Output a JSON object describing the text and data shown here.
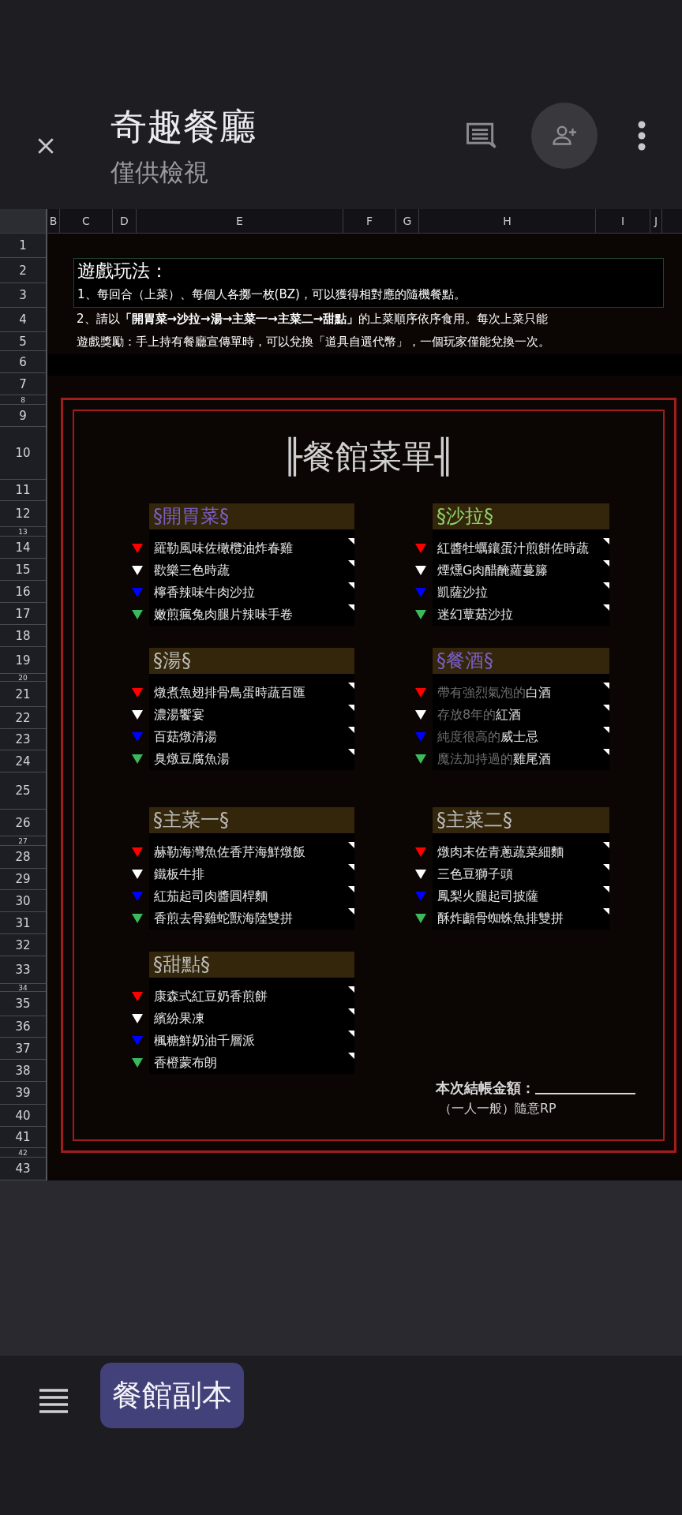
{
  "toolbar": {
    "title": "奇趣餐廳",
    "subtitle": "僅供檢視"
  },
  "columns": [
    "B",
    "C",
    "D",
    "E",
    "F",
    "G",
    "H",
    "I",
    "J"
  ],
  "rows": [
    "1",
    "2",
    "3",
    "4",
    "5",
    "6",
    "7",
    "8",
    "9",
    "10",
    "11",
    "12",
    "13",
    "14",
    "15",
    "16",
    "17",
    "18",
    "19",
    "20",
    "21",
    "22",
    "23",
    "24",
    "25",
    "26",
    "27",
    "28",
    "29",
    "30",
    "31",
    "32",
    "33",
    "34",
    "35",
    "36",
    "37",
    "38",
    "39",
    "40",
    "41",
    "42",
    "43"
  ],
  "rules": {
    "title": "遊戲玩法：",
    "lines": [
      "1、每回合（上菜）、每個人各擲一枚(BZ)，可以獲得相對應的隨機餐點。",
      "2、請以**「開胃菜→沙拉→湯→主菜一→主菜二→甜點」**的上菜順序依序食用。每次上菜只能",
      "遊戲獎勵：手上持有餐廳宣傳單時，可以兌換「道具自選代幣」，一個玩家僅能兌換一次。"
    ]
  },
  "menu": {
    "title": "╟餐館菜單╢",
    "sections": [
      {
        "title": "§開胃菜§",
        "color": "#7b5fc4",
        "items": [
          {
            "name": "羅勒風味佐橄欖油炸春雞",
            "color": "#ff0000"
          },
          {
            "name": "歡樂三色時蔬",
            "color": "#ffffff"
          },
          {
            "name": "檸香辣味牛肉沙拉",
            "color": "#0000ff"
          },
          {
            "name": "嫩煎瘋兔肉腿片辣味手卷",
            "color": "#3cb95a"
          }
        ]
      },
      {
        "title": "§沙拉§",
        "color": "#8fd06a",
        "items": [
          {
            "name": "紅醬牡蠣鑲蛋汁煎餅佐時蔬",
            "color": "#ff0000"
          },
          {
            "name": "煙燻G肉醋醃蘿蔓籐",
            "color": "#ffffff"
          },
          {
            "name": "凱薩沙拉",
            "color": "#0000ff"
          },
          {
            "name": "迷幻蕈菇沙拉",
            "color": "#3cb95a"
          }
        ]
      },
      {
        "title": "§湯§",
        "color": "#bbbbbb",
        "items": [
          {
            "name": "燉煮魚翅排骨鳥蛋時蔬百匯",
            "color": "#ff0000"
          },
          {
            "name": "濃湯饗宴",
            "color": "#ffffff"
          },
          {
            "name": "百菇燉清湯",
            "color": "#0000ff"
          },
          {
            "name": "臭燉豆腐魚湯",
            "color": "#3cb95a"
          }
        ]
      },
      {
        "title": "§餐酒§",
        "color": "#7b5fc4",
        "items": [
          {
            "prefix": "帶有強烈氣泡的",
            "name": "白酒",
            "color": "#ff0000"
          },
          {
            "prefix": "存放8年的",
            "name": "紅酒",
            "color": "#ffffff"
          },
          {
            "prefix": "純度很高的",
            "name": "威士忌",
            "color": "#0000ff"
          },
          {
            "prefix": "魔法加持過的",
            "name": "雞尾酒",
            "color": "#3cb95a"
          }
        ]
      },
      {
        "title": "§主菜一§",
        "color": "#bbbbbb",
        "items": [
          {
            "name": "赫勒海灣魚佐香芹海鮮燉飯",
            "color": "#ff0000"
          },
          {
            "name": "鐵板牛排",
            "color": "#ffffff"
          },
          {
            "name": "紅茄起司肉醬圓桿麵",
            "color": "#0000ff"
          },
          {
            "name": "香煎去骨雞蛇獸海陸雙拼",
            "color": "#3cb95a"
          }
        ]
      },
      {
        "title": "§主菜二§",
        "color": "#bbbbbb",
        "items": [
          {
            "name": "燉肉末佐青蔥蔬菜細麵",
            "color": "#ff0000"
          },
          {
            "name": "三色豆獅子頭",
            "color": "#ffffff"
          },
          {
            "name": "鳳梨火腿起司披薩",
            "color": "#0000ff"
          },
          {
            "name": "酥炸顱骨蜘蛛魚排雙拼",
            "color": "#3cb95a"
          }
        ]
      },
      {
        "title": "§甜點§",
        "color": "#bbbbbb",
        "items": [
          {
            "name": "康森式紅豆奶香煎餅",
            "color": "#ff0000"
          },
          {
            "name": "繽紛果凍",
            "color": "#ffffff"
          },
          {
            "name": "楓糖鮮奶油千層派",
            "color": "#0000ff"
          },
          {
            "name": "香橙蒙布朗",
            "color": "#3cb95a"
          }
        ]
      }
    ],
    "checkout": {
      "label": "本次結帳金額：",
      "note": "（一人一般）隨意RP"
    }
  },
  "sheet_tabs": [
    {
      "label": "餐館副本",
      "selected": true
    }
  ]
}
